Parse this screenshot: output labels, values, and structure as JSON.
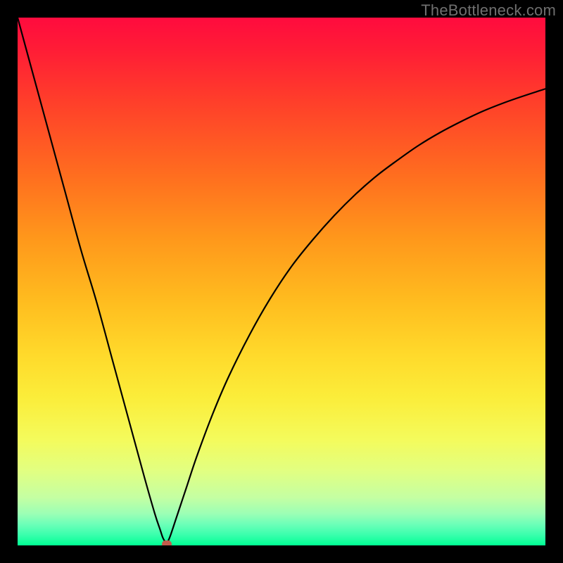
{
  "watermark": "TheBottleneck.com",
  "chart_data": {
    "type": "line",
    "title": "",
    "xlabel": "",
    "ylabel": "",
    "xlim": [
      0,
      100
    ],
    "ylim": [
      0,
      100
    ],
    "grid": false,
    "series": [
      {
        "name": "curve",
        "x": [
          0,
          3,
          6,
          9,
          12,
          15,
          18,
          21,
          24,
          26,
          27,
          27.5,
          28,
          28.2,
          28.5,
          29,
          30,
          31,
          32,
          34,
          37,
          40,
          44,
          48,
          52,
          56,
          60,
          64,
          68,
          72,
          76,
          80,
          84,
          88,
          92,
          96,
          100
        ],
        "y": [
          100,
          89,
          78,
          67,
          56,
          46,
          35,
          24,
          13,
          6,
          3,
          1.5,
          0.6,
          0.3,
          0.8,
          2,
          5,
          8,
          11,
          17,
          25,
          32,
          40,
          47,
          53,
          58,
          62.5,
          66.5,
          70,
          73,
          75.8,
          78.2,
          80.3,
          82.2,
          83.8,
          85.2,
          86.5
        ]
      }
    ],
    "marker": {
      "x": 28.2,
      "y": 0.3
    },
    "background_gradient": {
      "direction": "vertical",
      "stops": [
        {
          "pos": 0,
          "color": "#ff0b3e"
        },
        {
          "pos": 50,
          "color": "#ffbd1f"
        },
        {
          "pos": 80,
          "color": "#f4fb5c"
        },
        {
          "pos": 100,
          "color": "#00ff94"
        }
      ]
    }
  }
}
